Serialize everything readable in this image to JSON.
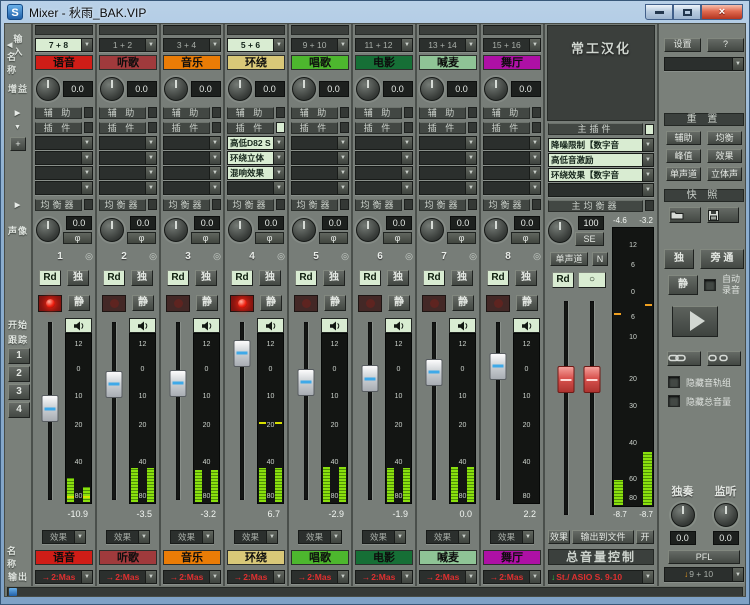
{
  "window": {
    "title": "Mixer -  秋雨_BAK.VIP"
  },
  "header": {
    "brand": "常工汉化",
    "settings": "设置",
    "help": "?"
  },
  "left_column": {
    "input": "输入",
    "name": "名 称",
    "gain": "增益",
    "pan": "声像",
    "start": "开始",
    "follow": "跟踪",
    "groups": [
      "1",
      "2",
      "3",
      "4"
    ],
    "name_bottom": "名 称",
    "output": "输出",
    "add": "+"
  },
  "channel_rows": {
    "aux": "辅 助",
    "plugin": "插 件",
    "eq": "均衡器",
    "fx": "效果",
    "phase": "φ",
    "target": "◎"
  },
  "channel_controls": {
    "rd": "Rd",
    "solo": "独",
    "mute": "静"
  },
  "icons": {
    "dropdown": "▼",
    "expand": "▶",
    "collapse": "▼",
    "output_arrow": "→",
    "down_arrow": "↓",
    "circle": "○"
  },
  "scales": {
    "channel": [
      "12",
      "0",
      "10",
      "20",
      "40",
      "80"
    ],
    "master": [
      "12",
      "6",
      "0",
      "6",
      "10",
      "20",
      "30",
      "40",
      "60",
      "80"
    ]
  },
  "channels": [
    {
      "number": "1",
      "input": "7 + 8",
      "input_active": true,
      "name": "语音",
      "color": "#d01d17",
      "gain": "0.0",
      "pan": "0.0",
      "plugins": [
        "",
        "",
        "",
        ""
      ],
      "plugin_active": false,
      "record_on": true,
      "fader_db": -10.9,
      "readout": "-10.9",
      "meter_l": 14,
      "meter_r": 9,
      "peak_pct": 3,
      "output": "2:Mas"
    },
    {
      "number": "2",
      "input": "1 + 2",
      "input_active": false,
      "name": "听歌",
      "color": "#a03a3c",
      "gain": "0.0",
      "pan": "0.0",
      "plugins": [
        "",
        "",
        "",
        ""
      ],
      "plugin_active": false,
      "record_on": false,
      "fader_db": -3.5,
      "readout": "-3.5",
      "meter_l": 20,
      "meter_r": 20,
      "peak_pct": null,
      "output": "2:Mas"
    },
    {
      "number": "3",
      "input": "3 + 4",
      "input_active": false,
      "name": "音乐",
      "color": "#ea7c06",
      "gain": "0.0",
      "pan": "0.0",
      "plugins": [
        "",
        "",
        "",
        ""
      ],
      "plugin_active": false,
      "record_on": false,
      "fader_db": -3.2,
      "readout": "-3.2",
      "meter_l": 19,
      "meter_r": 19,
      "peak_pct": null,
      "output": "2:Mas"
    },
    {
      "number": "4",
      "input": "5 + 6",
      "input_active": true,
      "name": "环绕",
      "color": "#d9c878",
      "gain": "0.0",
      "pan": "0.0",
      "plugins": [
        "高低D82 S",
        "环绕立体",
        "混响效果",
        ""
      ],
      "plugin_active": true,
      "record_on": true,
      "fader_db": 6.7,
      "readout": "6.7",
      "meter_l": 20,
      "meter_r": 20,
      "peak_pct": 47,
      "output": "2:Mas"
    },
    {
      "number": "5",
      "input": "9 + 10",
      "input_active": false,
      "name": "唱歌",
      "color": "#4db72e",
      "gain": "0.0",
      "pan": "0.0",
      "plugins": [
        "",
        "",
        "",
        ""
      ],
      "plugin_active": false,
      "record_on": false,
      "fader_db": -2.9,
      "readout": "-2.9",
      "meter_l": 21,
      "meter_r": 21,
      "peak_pct": null,
      "output": "2:Mas"
    },
    {
      "number": "6",
      "input": "11 + 12",
      "input_active": false,
      "name": "电影",
      "color": "#166f36",
      "gain": "0.0",
      "pan": "0.0",
      "plugins": [
        "",
        "",
        "",
        ""
      ],
      "plugin_active": false,
      "record_on": false,
      "fader_db": -1.9,
      "readout": "-1.9",
      "meter_l": 20,
      "meter_r": 20,
      "peak_pct": null,
      "output": "2:Mas"
    },
    {
      "number": "7",
      "input": "13 + 14",
      "input_active": false,
      "name": "喊麦",
      "color": "#8fc496",
      "gain": "0.0",
      "pan": "0.0",
      "plugins": [
        "",
        "",
        "",
        ""
      ],
      "plugin_active": false,
      "record_on": false,
      "fader_db": 0.0,
      "readout": "0.0",
      "meter_l": 21,
      "meter_r": 21,
      "peak_pct": null,
      "output": "2:Mas"
    },
    {
      "number": "8",
      "input": "15 + 16",
      "input_active": false,
      "name": "舞厅",
      "color": "#ae10a5",
      "gain": "0.0",
      "pan": "0.0",
      "plugins": [
        "",
        "",
        "",
        ""
      ],
      "plugin_active": false,
      "record_on": false,
      "fader_db": 2.2,
      "readout": "2.2",
      "meter_l": 0,
      "meter_r": 0,
      "peak_pct": null,
      "output": "2:Mas"
    }
  ],
  "master": {
    "plugin_header": "主插件",
    "plugins": [
      "降噪限制【数字音",
      "高低音激励",
      "环绕效果【数字音",
      ""
    ],
    "eq_header": "主均衡器",
    "eq_value": "100",
    "se": "SE",
    "peak_l_label": "-4.6",
    "peak_r_label": "-3.2",
    "mono": "单声道",
    "n": "N",
    "rd": "Rd",
    "fader_db": -5.0,
    "meter_l": 9,
    "meter_r": 19,
    "peak_l": 69,
    "peak_r": 72,
    "readout_l": "-8.7",
    "readout_r": "-8.7",
    "fx": "效果",
    "to_file": "输出到文件",
    "on": "开",
    "volume_header": "总音量控制",
    "output": "St./ ASIO S.  9-10"
  },
  "right_panel": {
    "reset_header": "重 置",
    "reset_buttons": [
      "辅助",
      "均衡",
      "峰值",
      "效果",
      "单声道",
      "立体声"
    ],
    "snapshot_header": "快 照",
    "solo": "独",
    "bypass": "旁 通",
    "mute": "静",
    "auto_line1": "自动",
    "auto_line2": "录音",
    "hide_tracks": "隐藏音轨组",
    "hide_master": "隐藏总音量",
    "solo_knob_label": "独奏",
    "monitor_knob_label": "监听",
    "solo_knob_value": "0.0",
    "monitor_knob_value": "0.0",
    "pfl": "PFL",
    "pfl_output": "9 + 10"
  }
}
